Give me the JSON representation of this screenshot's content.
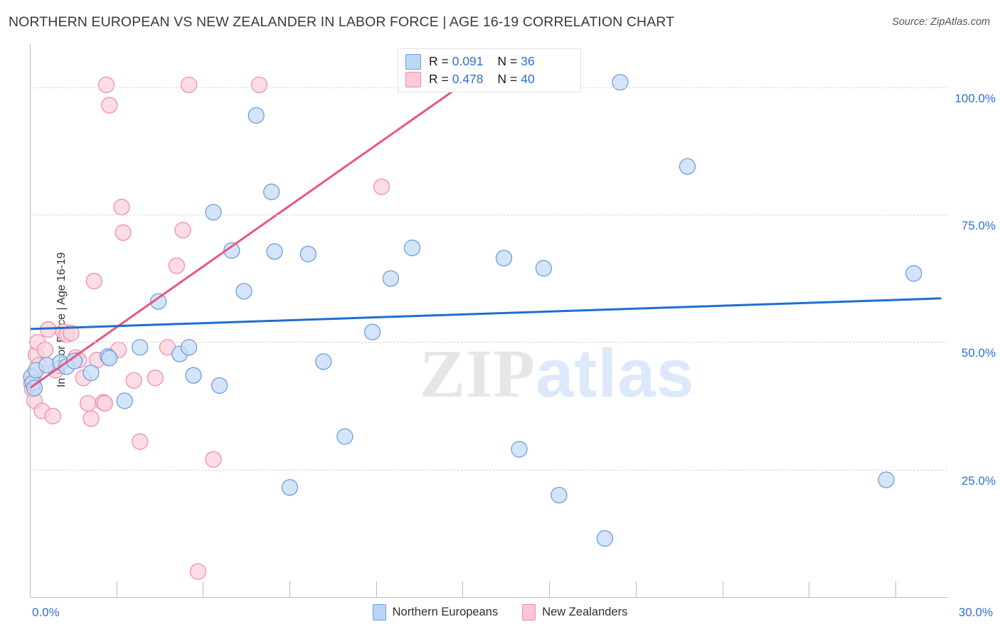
{
  "header": {
    "title": "NORTHERN EUROPEAN VS NEW ZEALANDER IN LABOR FORCE | AGE 16-19 CORRELATION CHART",
    "source": "Source: ZipAtlas.com"
  },
  "watermark": {
    "part1": "ZIP",
    "part2": "atlas"
  },
  "stats": {
    "rows": [
      {
        "color": "blue",
        "r_label": "R =",
        "r_value": "0.091",
        "n_label": "N =",
        "n_value": "36"
      },
      {
        "color": "pink",
        "r_label": "R =",
        "r_value": "0.478",
        "n_label": "N =",
        "n_value": "40"
      }
    ]
  },
  "legend": {
    "items": [
      {
        "label": "Northern Europeans",
        "color": "#b9d4f6"
      },
      {
        "label": "New Zealanders",
        "color": "#fbc6d6"
      }
    ]
  },
  "colors": {
    "blue_fill": "#c6dcf7",
    "blue_stroke": "#6c9ede",
    "pink_fill": "#fbd2de",
    "pink_stroke": "#ef8fac",
    "blue_line": "#1f6fd0",
    "pink_line": "#e8567f",
    "tick_text": "#2e6fd4",
    "grid": "#d8d8d8"
  },
  "chart_data": {
    "type": "scatter",
    "title": "NORTHERN EUROPEAN VS NEW ZEALANDER IN LABOR FORCE | AGE 16-19 CORRELATION CHART",
    "xlabel": "",
    "ylabel": "In Labor Force | Age 16-19",
    "xlim": [
      0,
      30
    ],
    "ylim": [
      0,
      108.5
    ],
    "x_tick_labels": [
      "0.0%",
      "30.0%"
    ],
    "y_tick_labels": [
      "25.0%",
      "50.0%",
      "75.0%",
      "100.0%"
    ],
    "y_ticks": [
      25,
      50,
      75,
      100
    ],
    "grid": "horizontal-dashed",
    "legend_position": "bottom-center",
    "series": [
      {
        "name": "Northern Europeans",
        "color": "#c6dcf7",
        "R": 0.091,
        "N": 36,
        "trend_line": {
          "x0": 0,
          "y0": 52.6,
          "x1": 29.8,
          "y1": 58.6
        },
        "points": [
          [
            0.05,
            43.2
          ],
          [
            0.1,
            42.0
          ],
          [
            0.15,
            41.0
          ],
          [
            0.2,
            44.5
          ],
          [
            0.55,
            45.5
          ],
          [
            1.0,
            46.0
          ],
          [
            1.2,
            45.2
          ],
          [
            1.45,
            46.3
          ],
          [
            2.0,
            44.0
          ],
          [
            2.55,
            47.2
          ],
          [
            2.6,
            46.9
          ],
          [
            3.1,
            38.5
          ],
          [
            3.6,
            49.0
          ],
          [
            4.2,
            58.0
          ],
          [
            4.9,
            47.7
          ],
          [
            5.2,
            49.0
          ],
          [
            5.35,
            43.5
          ],
          [
            6.0,
            75.5
          ],
          [
            6.2,
            41.5
          ],
          [
            6.6,
            68.0
          ],
          [
            7.0,
            60.0
          ],
          [
            7.4,
            94.5
          ],
          [
            7.9,
            79.5
          ],
          [
            8.0,
            67.8
          ],
          [
            8.5,
            21.5
          ],
          [
            9.1,
            67.3
          ],
          [
            9.6,
            46.2
          ],
          [
            10.3,
            31.5
          ],
          [
            11.2,
            52.0
          ],
          [
            11.8,
            62.5
          ],
          [
            12.5,
            68.5
          ],
          [
            15.5,
            66.5
          ],
          [
            16.0,
            29.0
          ],
          [
            16.8,
            64.5
          ],
          [
            17.3,
            20.0
          ],
          [
            18.8,
            11.5
          ],
          [
            19.3,
            101.0
          ],
          [
            21.5,
            84.5
          ],
          [
            28.0,
            23.0
          ],
          [
            28.9,
            63.5
          ]
        ]
      },
      {
        "name": "New Zealanders",
        "color": "#fbd2de",
        "R": 0.478,
        "N": 40,
        "trend_line": {
          "x0": 0,
          "y0": 41.0,
          "x1": 14.6,
          "y1": 102.5
        },
        "points": [
          [
            0.05,
            42.0
          ],
          [
            0.08,
            40.8
          ],
          [
            0.12,
            43.5
          ],
          [
            0.15,
            38.5
          ],
          [
            0.2,
            47.5
          ],
          [
            0.25,
            50.0
          ],
          [
            0.3,
            45.5
          ],
          [
            0.4,
            36.5
          ],
          [
            0.5,
            48.5
          ],
          [
            0.6,
            52.5
          ],
          [
            0.75,
            35.5
          ],
          [
            0.85,
            44.5
          ],
          [
            1.1,
            52.0
          ],
          [
            1.2,
            51.5
          ],
          [
            1.35,
            51.8
          ],
          [
            1.5,
            47.0
          ],
          [
            1.6,
            46.5
          ],
          [
            1.75,
            43.0
          ],
          [
            1.9,
            38.0
          ],
          [
            2.0,
            35.0
          ],
          [
            2.1,
            62.0
          ],
          [
            2.2,
            46.5
          ],
          [
            2.4,
            38.2
          ],
          [
            2.45,
            38.0
          ],
          [
            2.5,
            100.5
          ],
          [
            2.6,
            96.5
          ],
          [
            2.9,
            48.5
          ],
          [
            3.0,
            76.5
          ],
          [
            3.05,
            71.5
          ],
          [
            3.4,
            42.5
          ],
          [
            3.6,
            30.5
          ],
          [
            4.1,
            43.0
          ],
          [
            4.5,
            49.0
          ],
          [
            4.8,
            65.0
          ],
          [
            5.0,
            72.0
          ],
          [
            5.2,
            100.5
          ],
          [
            5.5,
            5.0
          ],
          [
            6.0,
            27.0
          ],
          [
            7.5,
            100.5
          ],
          [
            11.5,
            80.5
          ]
        ]
      }
    ]
  }
}
